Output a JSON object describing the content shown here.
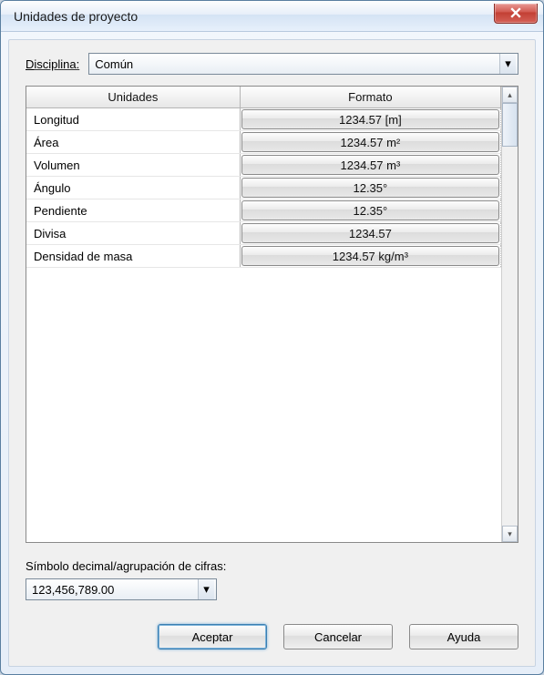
{
  "window": {
    "title": "Unidades de proyecto"
  },
  "discipline": {
    "label": "Disciplina:",
    "value": "Común"
  },
  "table": {
    "headers": {
      "units": "Unidades",
      "format": "Formato"
    },
    "rows": [
      {
        "unit": "Longitud",
        "format": "1234.57 [m]"
      },
      {
        "unit": "Área",
        "format": "1234.57 m²"
      },
      {
        "unit": "Volumen",
        "format": "1234.57 m³"
      },
      {
        "unit": "Ángulo",
        "format": "12.35°"
      },
      {
        "unit": "Pendiente",
        "format": "12.35°"
      },
      {
        "unit": "Divisa",
        "format": "1234.57"
      },
      {
        "unit": "Densidad de masa",
        "format": "1234.57 kg/m³"
      }
    ]
  },
  "decimal": {
    "label": "Símbolo decimal/agrupación de cifras:",
    "value": "123,456,789.00"
  },
  "buttons": {
    "ok": "Aceptar",
    "cancel": "Cancelar",
    "help": "Ayuda"
  }
}
